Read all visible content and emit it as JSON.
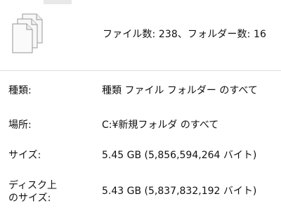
{
  "summary": {
    "icon": "files-stack-icon",
    "text": "ファイル数: 238、フォルダー数: 16"
  },
  "properties": [
    {
      "label": "種類:",
      "value": "種類 ファイル フォルダー のすべて"
    },
    {
      "label": "場所:",
      "value": "C:¥新規フォルダ のすべて"
    },
    {
      "label": "サイズ:",
      "value": "5.45 GB (5,856,594,264 バイト)"
    },
    {
      "label_line1": "ディスク上",
      "label_line2": "のサイズ:",
      "value": "5.43 GB (5,837,832,192 バイト)"
    }
  ]
}
